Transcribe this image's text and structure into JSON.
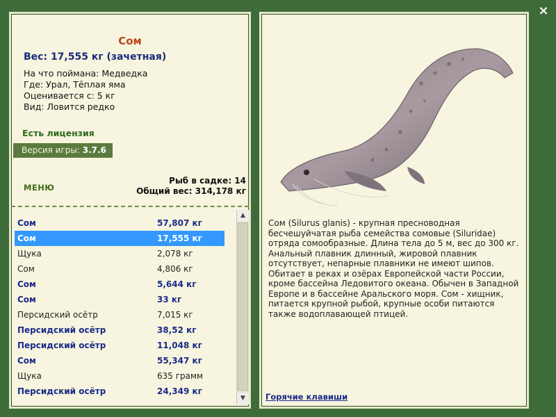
{
  "window": {
    "close_symbol": "×"
  },
  "fish": {
    "name": "Сом",
    "weight": "Вес: 17,555 кг (зачетная)",
    "caught_on": "На что поймана: Медведка",
    "where": "Где: Урал, Тёплая яма",
    "valued_from": "Оценивается с: 5 кг",
    "type": "Вид: Ловится редко"
  },
  "license": "Есть лицензия",
  "version": {
    "label": "Версия игры:",
    "value": "3.7.6"
  },
  "menu_label": "МЕНЮ",
  "stats": {
    "count": "Рыб в садке: 14",
    "total": "Общий вес: 314,178 кг"
  },
  "list": [
    {
      "name": "Сом",
      "weight": "57,807 кг",
      "style": "bold"
    },
    {
      "name": "Сом",
      "weight": "17,555 кг",
      "style": "selected"
    },
    {
      "name": "Щука",
      "weight": "2,078 кг",
      "style": "plain"
    },
    {
      "name": "Сом",
      "weight": "4,806 кг",
      "style": "plain"
    },
    {
      "name": "Сом",
      "weight": "5,644 кг",
      "style": "bold"
    },
    {
      "name": "Сом",
      "weight": "33 кг",
      "style": "bold"
    },
    {
      "name": "Персидский осётр",
      "weight": "7,015 кг",
      "style": "plain"
    },
    {
      "name": "Персидский осётр",
      "weight": "38,52 кг",
      "style": "bold"
    },
    {
      "name": "Персидский осётр",
      "weight": "11,048 кг",
      "style": "bold"
    },
    {
      "name": "Сом",
      "weight": "55,347 кг",
      "style": "bold"
    },
    {
      "name": "Щука",
      "weight": "635 грамм",
      "style": "plain"
    },
    {
      "name": "Персидский осётр",
      "weight": "24,349 кг",
      "style": "bold"
    }
  ],
  "description": "Сом (Silurus glanis) - крупная пресноводная бесчешуйчатая рыба семейства сомовые (Siluridae) отряда сомообразные. Длина тела до 5 м, вес до 300 кг. Анальный плавник длинный, жировой плавник отсутствует, непарные плавники не имеют шипов. Обитает в реках и озёрах Европейской части России, кроме бассейна Ледовитого океана. Обычен в Западной Европе и в бассейне Аральского моря. Сом - хищник, питается крупной рыбой, крупные особи питаются также водоплавающей птицей.",
  "hotkeys": "Горячие клавиши",
  "colors": {
    "background": "#3e6b3a",
    "panel": "#f7f5df",
    "selected": "#3399ff",
    "accent_name": "#b8451a"
  }
}
